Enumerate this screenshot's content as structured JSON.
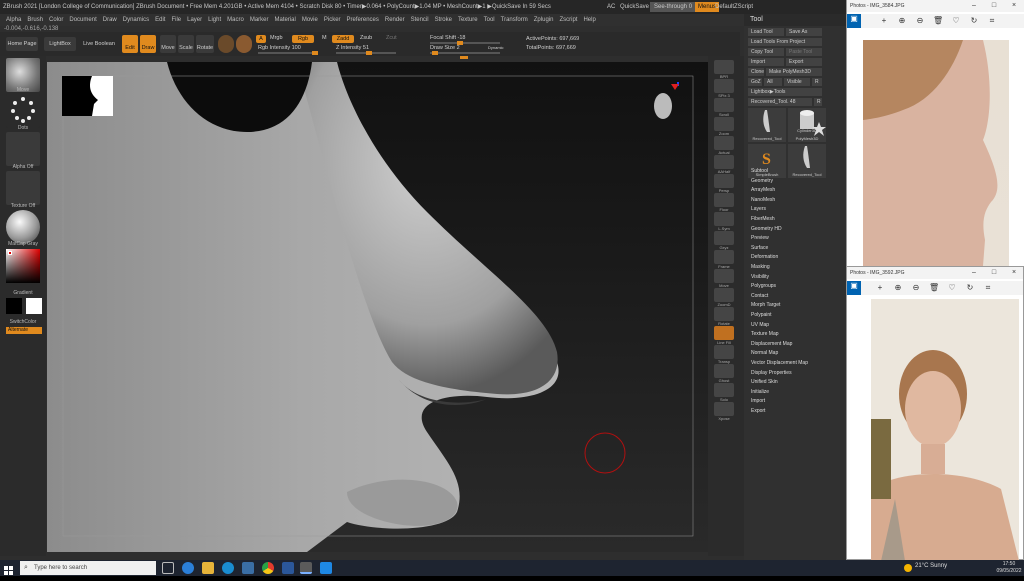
{
  "zbrush": {
    "title_bar": "ZBrush 2021 [London College of Communication]  ZBrush Document   • Free Mem 4.201GB • Active Mem 4104 • Scratch Disk 80 • Timer▶0.064 • PolyCount▶1.04 MP • MeshCount▶1  ▶QuickSave In 59 Secs",
    "ac": "AC",
    "quicksave": "QuickSave",
    "see_through": "See-through  0",
    "menus_btn": "Menus",
    "default_zscript": "DefaultZScript",
    "menu_items": [
      "Alpha",
      "Brush",
      "Color",
      "Document",
      "Draw",
      "Dynamics",
      "Edit",
      "File",
      "Layer",
      "Light",
      "Macro",
      "Marker",
      "Material",
      "Movie",
      "Picker",
      "Preferences",
      "Render",
      "Stencil",
      "Stroke",
      "Texture",
      "Tool",
      "Transform",
      "Zplugin",
      "Zscript",
      "Help"
    ],
    "coords": "-0.004,-0.616,-0.138",
    "shelf": {
      "home_page": "Home Page",
      "lightbox": "LightBox",
      "live_boolean": "Live Boolean",
      "edit": "Edit",
      "draw": "Draw",
      "move": "Move",
      "scale": "Scale",
      "rotate": "Rotate",
      "a_btn": "A",
      "mrgb": "Mrgb",
      "rgb": "Rgb",
      "m": "M",
      "zadd": "Zadd",
      "zsub": "Zsub",
      "zcut": "Zcut",
      "rgb_intensity": "Rgb Intensity 100",
      "z_intensity": "Z Intensity 51",
      "focal_shift": "Focal Shift -18",
      "draw_size": "Draw Size 2",
      "dynamic": "Dynamic",
      "active_points": "ActivePoints: 697,669",
      "total_points": "TotalPoints: 697,669"
    },
    "left_tray": {
      "move": "Move",
      "dots": "Dots",
      "alpha_off": "Alpha Off",
      "texture_off": "Texture Off",
      "matcap": "MatCap Gray",
      "gradient": "Gradient",
      "switch_color": "SwitchColor",
      "alternate": "Alternate"
    },
    "right_tray": [
      "BPR",
      "SPix 3",
      "Scroll",
      "Zoom",
      "Actual",
      "AAHalf",
      "Persp",
      "Floor",
      "L.Sym",
      "Gxyz",
      "Frame",
      "Move",
      "ZoomD",
      "Rotate",
      "Line Fill",
      "Transp",
      "Ghost",
      "Solo",
      "Xpose"
    ],
    "tool_panel": {
      "header": "Tool",
      "load_tool": "Load Tool",
      "save_as": "Save As",
      "load_from_project": "Load Tools From Project",
      "copy_tool": "Copy Tool",
      "paste_tool": "Paste Tool",
      "import": "Import",
      "export": "Export",
      "clone": "Clone",
      "make_polymesh": "Make PolyMesh3D",
      "goz": "GoZ",
      "all": "All",
      "visible": "Visible",
      "r": "R",
      "lightbox_tools": "Lightbox▶Tools",
      "recovered_tool": "Recovered_Tool. 48",
      "r2": "R",
      "thumb_labels": [
        "Recovered_Tool",
        "Cylinder3D",
        "PolyMesh3D",
        "SimpleBrush",
        "Recovered_Tool"
      ],
      "subpalettes": [
        "Subtool",
        "Geometry",
        "ArrayMesh",
        "NanoMesh",
        "Layers",
        "FiberMesh",
        "Geometry HD",
        "Preview",
        "Surface",
        "Deformation",
        "Masking",
        "Visibility",
        "Polygroups",
        "Contact",
        "Morph Target",
        "Polypaint",
        "UV Map",
        "Texture Map",
        "Displacement Map",
        "Normal Map",
        "Vector Displacement Map",
        "Display Properties",
        "Unified Skin",
        "Initialize",
        "Import",
        "Export"
      ]
    }
  },
  "photos1": {
    "title": "Photos - IMG_3584.JPG",
    "colors": {
      "accent": "#0063b1"
    }
  },
  "photos2": {
    "title": "Photos - IMG_3592.JPG"
  },
  "taskbar": {
    "search_placeholder": "Type here to search",
    "weather": "21°C  Sunny",
    "time": "17:50",
    "date": "09/05/2022"
  }
}
